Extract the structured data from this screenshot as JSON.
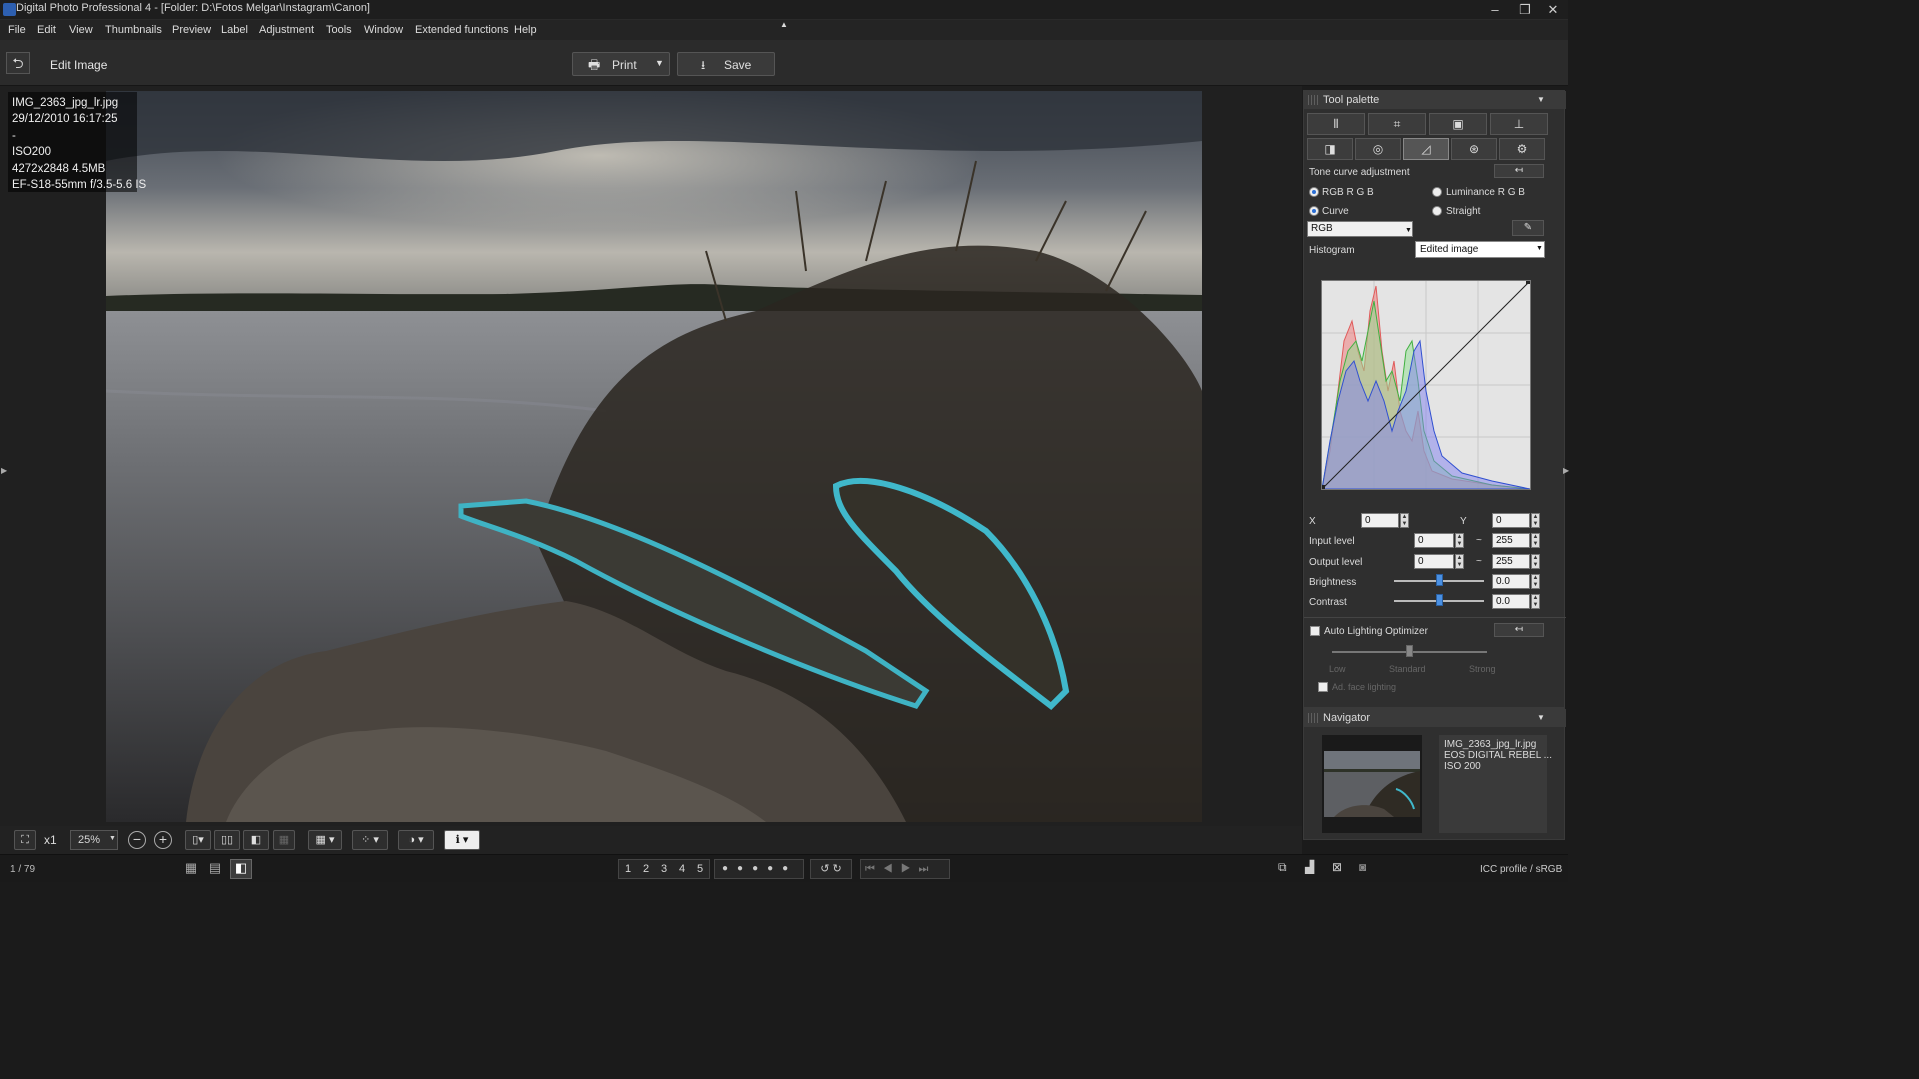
{
  "app": {
    "title": "Digital Photo Professional 4 - [Folder: D:\\Fotos Melgar\\Instagram\\Canon]"
  },
  "menu": [
    "File",
    "Edit",
    "View",
    "Thumbnails",
    "Preview",
    "Label",
    "Adjustment",
    "Tools",
    "Window",
    "Extended functions",
    "Help"
  ],
  "toolbar": {
    "mode_label": "Edit Image",
    "print_label": "Print",
    "save_label": "Save"
  },
  "image_info": {
    "filename": "IMG_2363_jpg_lr.jpg",
    "datetime": "29/12/2010 16:17:25",
    "dash": "-",
    "iso": "ISO200",
    "size": "4272x2848 4.5MB",
    "lens": "EF-S18-55mm f/3.5-5.6 IS"
  },
  "view_tools": {
    "zoom_mult": "x1",
    "zoom": "25%"
  },
  "status": {
    "counter": "1 / 79",
    "icc": "ICC profile / sRGB"
  },
  "rating_labels": [
    "1",
    "2",
    "3",
    "4",
    "5"
  ],
  "palette": {
    "title": "Tool palette",
    "section": "Tone curve adjustment",
    "mode_rgb": "RGB R G B",
    "mode_lum": "Luminance R G B",
    "curve": "Curve",
    "straight": "Straight",
    "channel": "RGB",
    "histogram_label": "Histogram",
    "histogram_value": "Edited image",
    "x_label": "X",
    "x_value": "0",
    "y_label": "Y",
    "y_value": "0",
    "input_label": "Input level",
    "input_low": "0",
    "input_high": "255",
    "output_label": "Output level",
    "output_low": "0",
    "output_high": "255",
    "tilde": "~",
    "brightness_label": "Brightness",
    "brightness_value": "0.0",
    "brightness_level": 0.5,
    "contrast_label": "Contrast",
    "contrast_value": "0.0",
    "contrast_level": 0.5,
    "alo_label": "Auto Lighting Optimizer",
    "alo_low": "Low",
    "alo_standard": "Standard",
    "alo_strong": "Strong",
    "face_label": "Ad. face lighting"
  },
  "navigator": {
    "title": "Navigator",
    "filename": "IMG_2363_jpg_lr.jpg",
    "camera": "EOS DIGITAL REBEL ...",
    "iso": "ISO 200"
  }
}
